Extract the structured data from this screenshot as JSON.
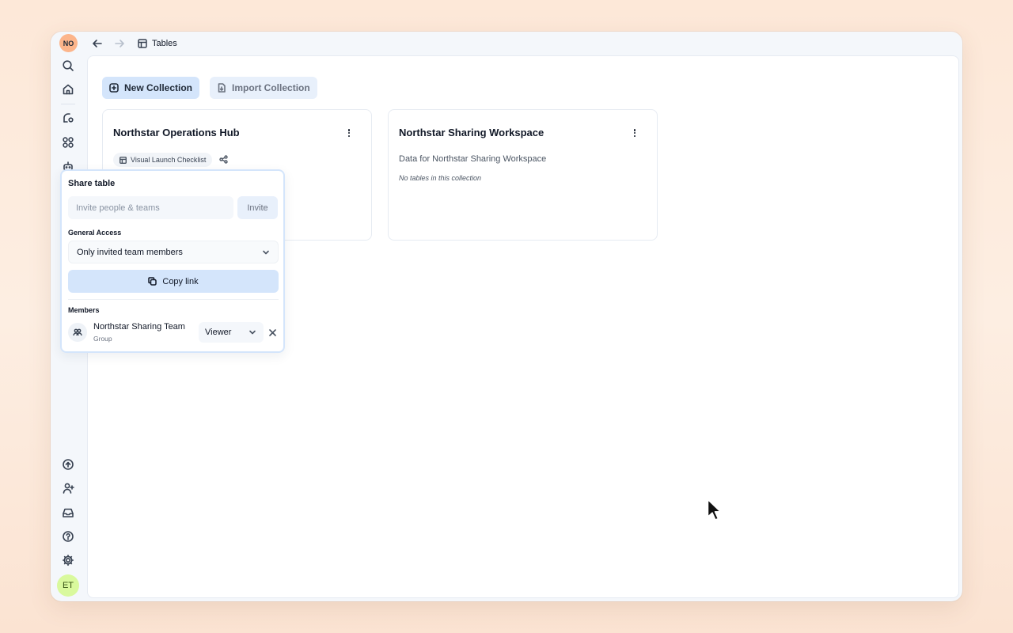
{
  "window": {
    "breadcrumb": {
      "icon": "table-icon",
      "label": "Tables"
    }
  },
  "sidebar": {
    "top_avatar_initials": "NO",
    "bottom_avatar_initials": "ET",
    "top_items": [
      {
        "name": "search",
        "icon": "search-icon"
      },
      {
        "name": "home",
        "icon": "home-icon"
      },
      {
        "name": "workflows",
        "icon": "workflow-icon"
      },
      {
        "name": "apps",
        "icon": "grid-icon"
      },
      {
        "name": "agents",
        "icon": "bot-icon"
      }
    ],
    "bottom_items": [
      {
        "name": "upgrade",
        "icon": "arrow-up-circle-icon"
      },
      {
        "name": "invite-user",
        "icon": "user-plus-icon"
      },
      {
        "name": "inbox",
        "icon": "inbox-icon"
      },
      {
        "name": "help",
        "icon": "help-circle-icon"
      },
      {
        "name": "settings",
        "icon": "gear-icon"
      }
    ]
  },
  "toolbar": {
    "new_collection_label": "New Collection",
    "import_collection_label": "Import Collection"
  },
  "collections": [
    {
      "title": "Northstar Operations Hub",
      "table_chip": "Visual Launch Checklist"
    },
    {
      "title": "Northstar Sharing Workspace",
      "description": "Data for Northstar Sharing Workspace",
      "empty_text": "No tables in this collection"
    }
  ],
  "share_popover": {
    "title": "Share table",
    "invite_placeholder": "Invite people & teams",
    "invite_value": "",
    "invite_button": "Invite",
    "general_access_label": "General Access",
    "general_access_value": "Only invited team members",
    "copy_link_label": "Copy link",
    "members_label": "Members",
    "members": [
      {
        "name": "Northstar Sharing Team",
        "type": "Group",
        "role": "Viewer"
      }
    ]
  },
  "colors": {
    "accent": "#d4e5fb",
    "top_avatar_bg": "#fcb58b",
    "bottom_avatar_bg": "#d9f99d"
  }
}
